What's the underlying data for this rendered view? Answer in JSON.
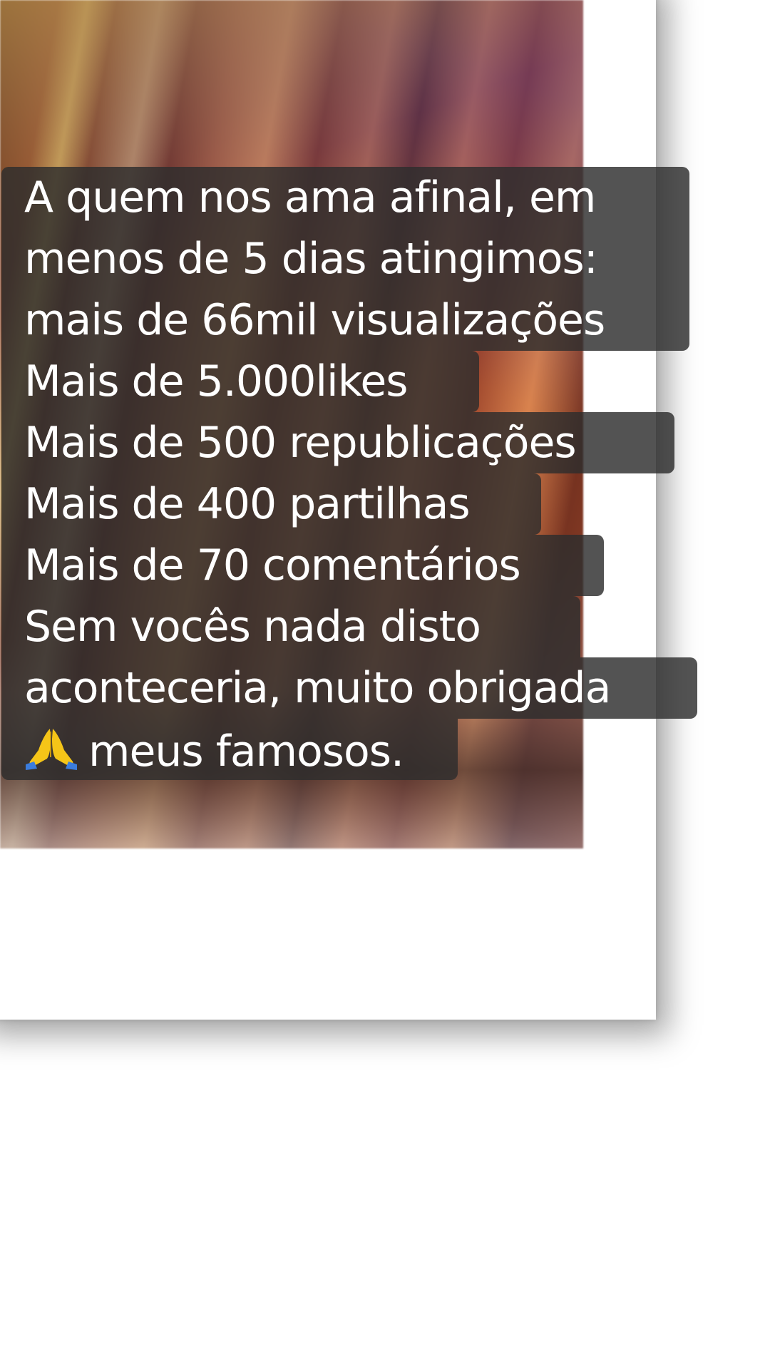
{
  "caption": {
    "lines": [
      "A quem nos ama afinal, em",
      "menos de 5 dias atingimos:",
      "mais de 66mil visualizações",
      "Mais de 5.000likes",
      "Mais de 500 republicações",
      "Mais de 400 partilhas",
      "Mais de 70 comentários",
      "Sem vocês nada disto",
      "aconteceria, muito obrigada",
      "meus famosos."
    ],
    "emoji": "praying-hands-icon"
  },
  "colors": {
    "caption_bg": "#2d2d2d",
    "caption_text": "#ffffff",
    "frame": "#ffffff"
  }
}
